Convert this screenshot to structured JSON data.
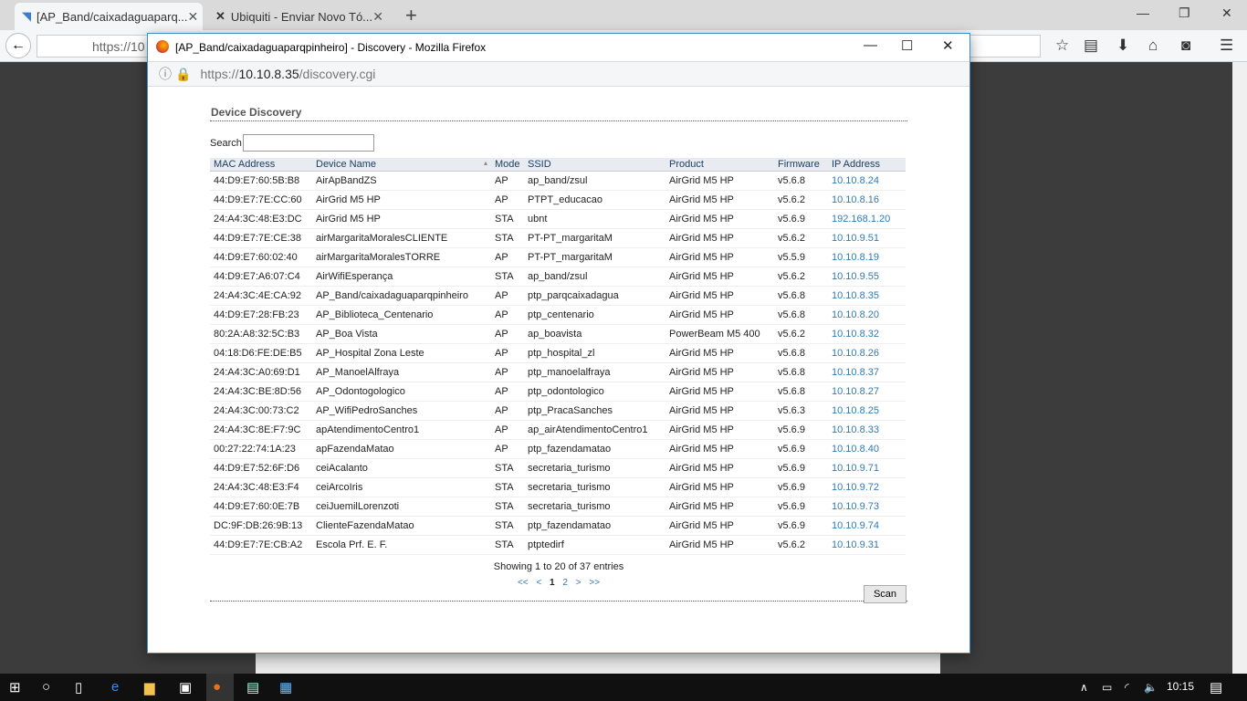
{
  "browser": {
    "tabs": [
      {
        "label": "[AP_Band/caixadaguaparq..."
      },
      {
        "label": "Ubiquiti - Enviar Novo Tó..."
      }
    ],
    "url_partial": "https://10"
  },
  "popup": {
    "title": "[AP_Band/caixadaguaparqpinheiro] - Discovery - Mozilla Firefox",
    "url_scheme": "https://",
    "url_host": "10.10.8.35",
    "url_path": "/discovery.cgi",
    "heading": "Device Discovery",
    "search_label": "Search",
    "search_value": "",
    "columns": [
      "MAC Address",
      "Device Name",
      "Mode",
      "SSID",
      "Product",
      "Firmware",
      "IP Address"
    ],
    "rows": [
      [
        "44:D9:E7:60:5B:B8",
        "AirApBandZS",
        "AP",
        "ap_band/zsul",
        "AirGrid M5 HP",
        "v5.6.8",
        "10.10.8.24"
      ],
      [
        "44:D9:E7:7E:CC:60",
        "AirGrid M5 HP",
        "AP",
        "PTPT_educacao",
        "AirGrid M5 HP",
        "v5.6.2",
        "10.10.8.16"
      ],
      [
        "24:A4:3C:48:E3:DC",
        "AirGrid M5 HP",
        "STA",
        "ubnt",
        "AirGrid M5 HP",
        "v5.6.9",
        "192.168.1.20"
      ],
      [
        "44:D9:E7:7E:CE:38",
        "airMargaritaMoralesCLIENTE",
        "STA",
        "PT-PT_margaritaM",
        "AirGrid M5 HP",
        "v5.6.2",
        "10.10.9.51"
      ],
      [
        "44:D9:E7:60:02:40",
        "airMargaritaMoralesTORRE",
        "AP",
        "PT-PT_margaritaM",
        "AirGrid M5 HP",
        "v5.5.9",
        "10.10.8.19"
      ],
      [
        "44:D9:E7:A6:07:C4",
        "AirWifiEsperança",
        "STA",
        "ap_band/zsul",
        "AirGrid M5 HP",
        "v5.6.2",
        "10.10.9.55"
      ],
      [
        "24:A4:3C:4E:CA:92",
        "AP_Band/caixadaguaparqpinheiro",
        "AP",
        "ptp_parqcaixadagua",
        "AirGrid M5 HP",
        "v5.6.8",
        "10.10.8.35"
      ],
      [
        "44:D9:E7:28:FB:23",
        "AP_Biblioteca_Centenario",
        "AP",
        "ptp_centenario",
        "AirGrid M5 HP",
        "v5.6.8",
        "10.10.8.20"
      ],
      [
        "80:2A:A8:32:5C:B3",
        "AP_Boa Vista",
        "AP",
        "ap_boavista",
        "PowerBeam M5 400",
        "v5.6.2",
        "10.10.8.32"
      ],
      [
        "04:18:D6:FE:DE:B5",
        "AP_Hospital Zona Leste",
        "AP",
        "ptp_hospital_zl",
        "AirGrid M5 HP",
        "v5.6.8",
        "10.10.8.26"
      ],
      [
        "24:A4:3C:A0:69:D1",
        "AP_ManoelAlfraya",
        "AP",
        "ptp_manoelalfraya",
        "AirGrid M5 HP",
        "v5.6.8",
        "10.10.8.37"
      ],
      [
        "24:A4:3C:BE:8D:56",
        "AP_Odontogologico",
        "AP",
        "ptp_odontologico",
        "AirGrid M5 HP",
        "v5.6.8",
        "10.10.8.27"
      ],
      [
        "24:A4:3C:00:73:C2",
        "AP_WifiPedroSanches",
        "AP",
        "ptp_PracaSanches",
        "AirGrid M5 HP",
        "v5.6.3",
        "10.10.8.25"
      ],
      [
        "24:A4:3C:8E:F7:9C",
        "apAtendimentoCentro1",
        "AP",
        "ap_airAtendimentoCentro1",
        "AirGrid M5 HP",
        "v5.6.9",
        "10.10.8.33"
      ],
      [
        "00:27:22:74:1A:23",
        "apFazendaMatao",
        "AP",
        "ptp_fazendamatao",
        "AirGrid M5 HP",
        "v5.6.9",
        "10.10.8.40"
      ],
      [
        "44:D9:E7:52:6F:D6",
        "ceiAcalanto",
        "STA",
        "secretaria_turismo",
        "AirGrid M5 HP",
        "v5.6.9",
        "10.10.9.71"
      ],
      [
        "24:A4:3C:48:E3:F4",
        "ceiArcoIris",
        "STA",
        "secretaria_turismo",
        "AirGrid M5 HP",
        "v5.6.9",
        "10.10.9.72"
      ],
      [
        "44:D9:E7:60:0E:7B",
        "ceiJuemilLorenzoti",
        "STA",
        "secretaria_turismo",
        "AirGrid M5 HP",
        "v5.6.9",
        "10.10.9.73"
      ],
      [
        "DC:9F:DB:26:9B:13",
        "ClienteFazendaMatao",
        "STA",
        "ptp_fazendamatao",
        "AirGrid M5 HP",
        "v5.6.9",
        "10.10.9.74"
      ],
      [
        "44:D9:E7:7E:CB:A2",
        "Escola Prf. E. F.",
        "STA",
        "ptptedirf",
        "AirGrid M5 HP",
        "v5.6.2",
        "10.10.9.31"
      ]
    ],
    "info": "Showing 1 to 20 of 37 entries",
    "pager": {
      "first": "<<",
      "prev": "<",
      "p1": "1",
      "p2": "2",
      "next": ">",
      "last": ">>"
    },
    "scan_label": "Scan"
  },
  "taskbar": {
    "clock": "10:15"
  }
}
